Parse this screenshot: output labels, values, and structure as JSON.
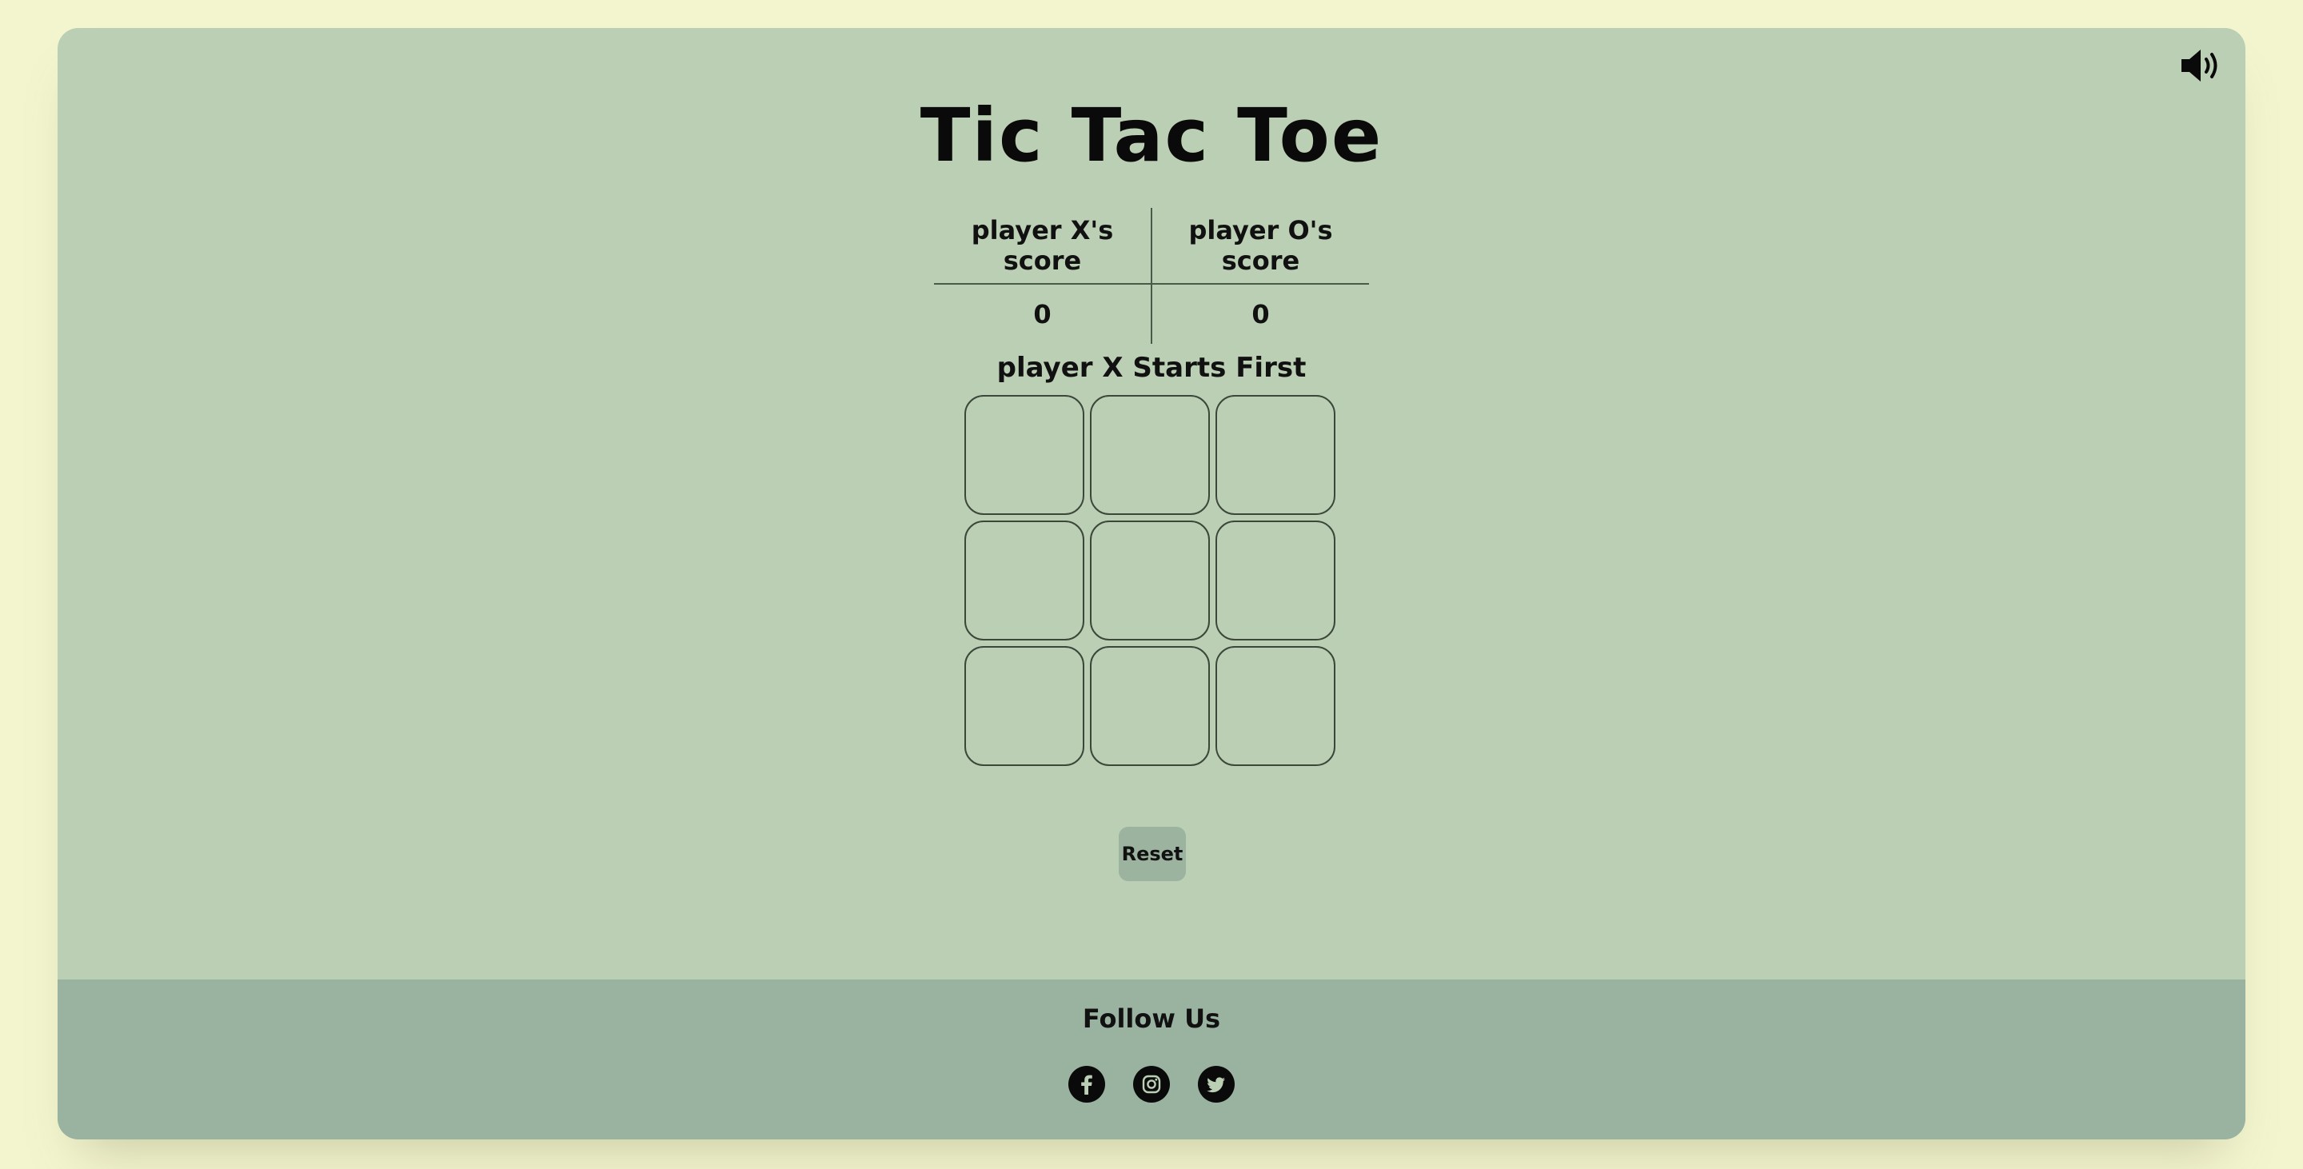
{
  "game": {
    "title": "Tic Tac Toe",
    "turn_message": "player X Starts First"
  },
  "scoreboard": {
    "headers": [
      "player X's score",
      "player O's score"
    ],
    "scores": [
      "0",
      "0"
    ]
  },
  "board": {
    "cells": [
      "",
      "",
      "",
      "",
      "",
      "",
      "",
      "",
      ""
    ]
  },
  "controls": {
    "reset_label": "Reset",
    "sound_icon": "speaker-volume-icon"
  },
  "footer": {
    "follow_label": "Follow Us",
    "social_icons": [
      "facebook-icon",
      "instagram-icon",
      "twitter-icon"
    ]
  },
  "colors": {
    "page_background": "#f3f5cf",
    "card_background": "#bbcfb4",
    "footer_background": "#9ab3a1",
    "button_background": "#9cb3a0",
    "text": "#111111"
  }
}
